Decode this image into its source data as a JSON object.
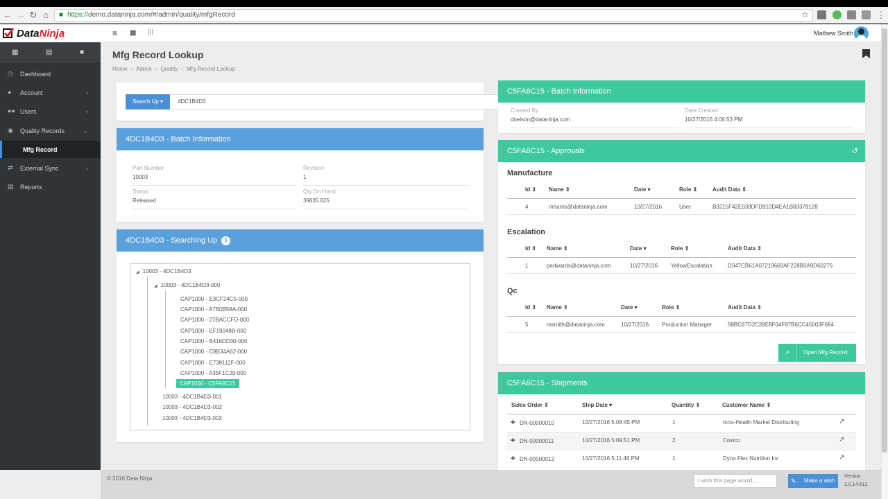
{
  "browser": {
    "url_proto": "https://",
    "url_rest": "demo.dataninja.com/#/admin/quality/mfgRecord"
  },
  "app": {
    "brand_a": "Data",
    "brand_b": "Ninja",
    "user_name": "Mathew Smith"
  },
  "sidebar": {
    "items": [
      {
        "label": "Dashboard",
        "icon": "dashboard-icon"
      },
      {
        "label": "Account",
        "icon": "user-icon"
      },
      {
        "label": "Users",
        "icon": "users-icon"
      },
      {
        "label": "Quality Records",
        "icon": "quality-icon"
      },
      {
        "label": "Mfg Record",
        "icon": ""
      },
      {
        "label": "External Sync",
        "icon": "sync-icon"
      },
      {
        "label": "Reports",
        "icon": "reports-icon"
      }
    ]
  },
  "page": {
    "title": "Mfg Record Lookup",
    "breadcrumb": [
      "Home",
      "Admin",
      "Quality",
      "Mfg Record Lookup"
    ]
  },
  "search": {
    "button_label": "Search Up",
    "value": "4DC1B4D3"
  },
  "batch_left": {
    "title": "4DC1B4D3 - Batch Information",
    "part_number_label": "Part Number",
    "part_number": "10003",
    "revision_label": "Revision",
    "revision": "1",
    "status_label": "Status",
    "status": "Released",
    "qty_label": "Qty On Hand",
    "qty": "39635.625"
  },
  "searching_up": {
    "title": "4DC1B4D3 - Searching Up",
    "root": "10003 - 4DC1B4D3",
    "child": "10003 - 4DC1B4D3-000",
    "leaves": [
      "CAP1000 - E3CF24C5-000",
      "CAP1000 - A7B0B58A-000",
      "CAP1000 - 27BACCFD-000",
      "CAP1000 - EF19048B-000",
      "CAP1000 - B416DD30-000",
      "CAP1000 - C8B34A62-000",
      "CAP1000 - E738112F-000",
      "CAP1000 - A35F1C29-000"
    ],
    "selected": "CAP1000 - C5FA6C15",
    "siblings": [
      "10003 - 4DC1B4D3-001",
      "10003 - 4DC1B4D3-002",
      "10003 - 4DC1B4D3-003"
    ]
  },
  "batch_right": {
    "title": "C5FA6C15 - Batch Information",
    "created_by_label": "Created By",
    "created_by": "dnelson@dataninja.com",
    "date_created_label": "Date Created",
    "date_created": "10/27/2016 4:06:53 PM"
  },
  "approvals": {
    "title": "C5FA6C15 - Approvals",
    "sections": [
      {
        "name": "Manufacture",
        "headers": [
          "Id",
          "Name",
          "Date",
          "Role",
          "Audit Data"
        ],
        "row": [
          "4",
          "mharris@dataninja.com",
          "10/27/2016",
          "User",
          "B3215F42E039DFD910D4EA1B83378128"
        ]
      },
      {
        "name": "Escalation",
        "headers": [
          "Id",
          "Name",
          "Date",
          "Role",
          "Audit Data"
        ],
        "row": [
          "1",
          "pedwards@dataninja.com",
          "10/27/2016",
          "YellowEscalation",
          "D347CB61A07219669AF228B0A9D60276"
        ]
      },
      {
        "name": "Qc",
        "headers": [
          "Id",
          "Name",
          "Date",
          "Role",
          "Audit Data"
        ],
        "row": [
          "5",
          "msmith@dataninja.com",
          "10/27/2016",
          "Production Manager",
          "58BC67D2C39E8F04F97B6CC45003F684"
        ]
      }
    ],
    "open_button": "Open Mfg Record"
  },
  "shipments": {
    "title": "C5FA6C15 - Shipments",
    "headers": [
      "Sales Order",
      "Ship Date",
      "Quantity",
      "Customer Name"
    ],
    "rows": [
      [
        "DN-00000010",
        "10/27/2016 5:08:45 PM",
        "1",
        "Inno-Health Market Distributing"
      ],
      [
        "DN-00000011",
        "10/27/2016 5:09:51 PM",
        "2",
        "Costco"
      ],
      [
        "DN-00000012",
        "10/27/2016 5:11:46 PM",
        "1",
        "Dyno Flex Nutrition Inc"
      ]
    ]
  },
  "footer": {
    "copyright": "© 2016 Data Ninja",
    "wish_placeholder": "I wish this page would...",
    "wish_button": "Make a wish",
    "version_label": "Version",
    "version": "2.0.14.613"
  }
}
